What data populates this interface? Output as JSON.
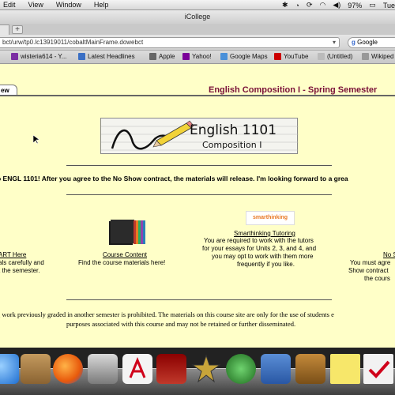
{
  "menubar": {
    "items": [
      "Edit",
      "View",
      "Window",
      "Help"
    ],
    "battery": "97%",
    "clock": "Tue"
  },
  "window": {
    "title": "iCollege"
  },
  "addressbar": {
    "url": "bct/urw/tp0.lc13919011/cobaltMainFrame.dowebct",
    "search_engine": "Google"
  },
  "bookmarks": [
    {
      "label": "wisteria614 - Y...",
      "color": "#7b2ea3"
    },
    {
      "label": "Latest Headlines",
      "color": "#3a6fc4"
    },
    {
      "label": "Apple",
      "color": "#666666"
    },
    {
      "label": "Yahoo!",
      "color": "#7b0099"
    },
    {
      "label": "Google Maps",
      "color": "#4a90d9"
    },
    {
      "label": "YouTube",
      "color": "#cc0000"
    },
    {
      "label": "(Untitled)",
      "color": "#bbbbbb"
    },
    {
      "label": "Wikiped",
      "color": "#999999"
    }
  ],
  "page": {
    "tab_label": "ew",
    "course_title": "English Composition I - Spring Semester",
    "banner_line1": "English 1101",
    "banner_line2": "Composition I",
    "welcome": "o ENGL 1101! After you agree to the No Show contract, the materials will release. I'm looking forward to a grea",
    "col1_link": "ART Here",
    "col1_line1": "als carefully and",
    "col1_line2": "t the semester.",
    "col2_link": "Course Content",
    "col2_line1": "Find the course materials here!",
    "smarthinking_logo": "smarthinking",
    "col3_link": "Smarthinking Tutoring",
    "col3_line1": "You are required to work with the tutors",
    "col3_line2": "for your essays for Units 2, 3, and 4, and",
    "col3_line3": "you may opt to work with them more",
    "col3_line4": "frequently if you like.",
    "col4_link": "No S",
    "col4_line1": "You must agre",
    "col4_line2": "Show contract",
    "col4_line3": "the cours",
    "disclaimer_line1": "g work previously graded in another semester is prohibited. The materials on this course site are only for the use of students e",
    "disclaimer_line2": "purposes associated with this course and may not be retained or further disseminated."
  },
  "dock": {
    "icons": [
      "finder-icon",
      "address-book-icon",
      "firefox-icon",
      "iphoto-icon",
      "acrobat-icon",
      "photo-booth-icon",
      "imovie-icon",
      "time-machine-icon",
      "itunes-icon",
      "keynote-icon",
      "stickies-icon",
      "calendar-icon"
    ]
  }
}
